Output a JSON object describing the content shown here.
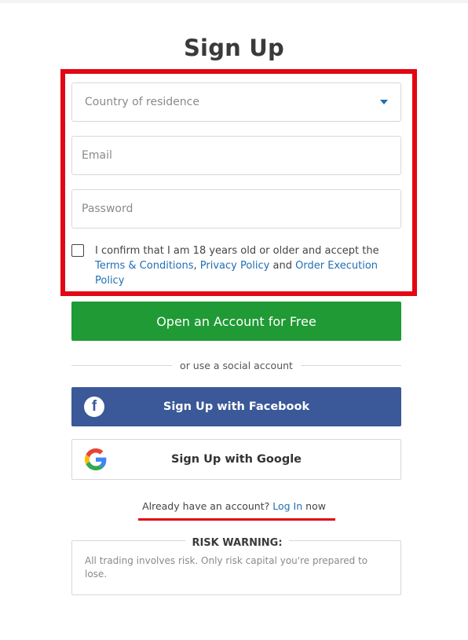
{
  "page": {
    "title": "Sign Up"
  },
  "form": {
    "country_placeholder": "Country of residence",
    "email_placeholder": "Email",
    "password_placeholder": "Password",
    "consent": {
      "text_before": "I confirm that I am 18 years old or older and accept the",
      "terms_link": "Terms & Conditions",
      "separator": ",",
      "privacy_link": "Privacy Policy",
      "and_text": "and",
      "execution_link": "Order Execution Policy"
    },
    "submit_label": "Open an Account for Free"
  },
  "social": {
    "divider_text": "or use a social account",
    "facebook_label": "Sign Up with Facebook",
    "google_label": "Sign Up with Google"
  },
  "login": {
    "prompt": "Already have an account?",
    "link": "Log In",
    "suffix": "now"
  },
  "risk": {
    "title": "RISK WARNING:",
    "text": "All trading involves risk. Only risk capital you're prepared to lose."
  },
  "colors": {
    "primary_green": "#1f9a34",
    "facebook_blue": "#3b5998",
    "link_blue": "#1f6fb5",
    "highlight_red": "#e30613"
  },
  "icons": {
    "facebook": "facebook-icon",
    "google": "google-icon",
    "dropdown": "chevron-down-icon"
  }
}
